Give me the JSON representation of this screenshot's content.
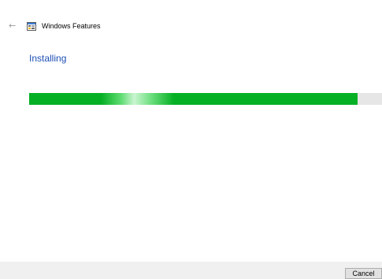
{
  "window": {
    "title": "Windows Features",
    "back_icon": "left-arrow-icon",
    "app_icon": "windows-features-icon"
  },
  "main": {
    "heading": "Installing",
    "progress": {
      "fraction": 0.93,
      "fill_color": "#06b025",
      "track_color": "#e6e6e6"
    }
  },
  "footer": {
    "cancel_label": "Cancel"
  },
  "colors": {
    "heading": "#1c4fb5",
    "footer_bg": "#f0f0f0"
  }
}
